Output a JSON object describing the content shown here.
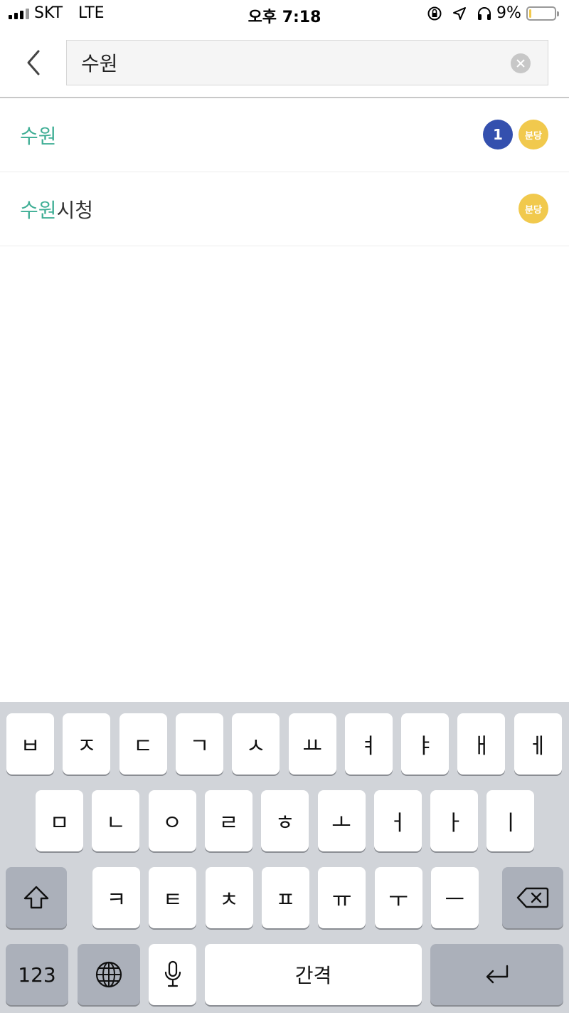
{
  "status_bar": {
    "carrier": "SKT",
    "network": "LTE",
    "time": "오후 7:18",
    "battery_percent": "9%",
    "battery_level": 0.09,
    "icons": [
      "orientation-lock-icon",
      "location-arrow-icon",
      "headphones-icon"
    ]
  },
  "search": {
    "back_icon": "chevron-left-icon",
    "query": "수원",
    "clear_icon": "clear-circle-icon"
  },
  "results": [
    {
      "highlight": "수원",
      "rest": "",
      "badges": [
        {
          "text": "1",
          "color": "#3450ae"
        },
        {
          "text": "분당",
          "color": "#f1c94d"
        }
      ]
    },
    {
      "highlight": "수원",
      "rest": "시청",
      "badges": [
        {
          "text": "분당",
          "color": "#f1c94d"
        }
      ]
    }
  ],
  "colors": {
    "highlight": "#3fae95",
    "line1": "#3450ae",
    "bundang": "#f1c94d"
  },
  "keyboard": {
    "row1": [
      "ㅂ",
      "ㅈ",
      "ㄷ",
      "ㄱ",
      "ㅅ",
      "ㅛ",
      "ㅕ",
      "ㅑ",
      "ㅐ",
      "ㅔ"
    ],
    "row2": [
      "ㅁ",
      "ㄴ",
      "ㅇ",
      "ㄹ",
      "ㅎ",
      "ㅗ",
      "ㅓ",
      "ㅏ",
      "ㅣ"
    ],
    "row3": [
      "ㅋ",
      "ㅌ",
      "ㅊ",
      "ㅍ",
      "ㅠ",
      "ㅜ",
      "ㅡ"
    ],
    "numbers_label": "123",
    "space_label": "간격",
    "shift_icon": "shift-icon",
    "delete_icon": "delete-icon",
    "globe_icon": "globe-icon",
    "mic_icon": "microphone-icon",
    "return_icon": "return-icon"
  }
}
